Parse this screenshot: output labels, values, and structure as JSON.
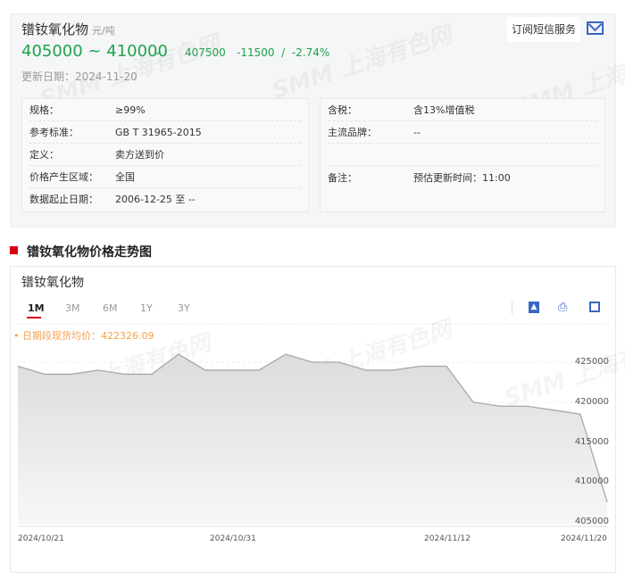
{
  "product": {
    "name": "镨钕氧化物",
    "unit": "元/吨",
    "price_range": "405000 ~ 410000",
    "trend_icon": "down-arrow-icon",
    "avg": "407500",
    "change": "-11500  /  -2.74%",
    "update_date": "更新日期：2024-11-20",
    "subscribe": "订阅短信服务"
  },
  "left_specs": [
    {
      "k": "规格：",
      "v": "≥99%"
    },
    {
      "k": "参考标准：",
      "v": "GB T 31965-2015"
    },
    {
      "k": "定义：",
      "v": "卖方送到价"
    },
    {
      "k": "价格产生区域：",
      "v": "全国"
    },
    {
      "k": "数据起止日期：",
      "v": "2006-12-25 至 --"
    }
  ],
  "right_specs": [
    {
      "k": "含税：",
      "v": "含13%增值税"
    },
    {
      "k": "主流品牌：",
      "v": "--"
    },
    {
      "k": "备注：",
      "v": "预估更新时间：11:00"
    }
  ],
  "section_title": "镨钕氧化物价格走势图",
  "watermark": "SMM 上海有色网",
  "chart_header": {
    "title": "镨钕氧化物",
    "tabs": [
      "1M",
      "3M",
      "6M",
      "1Y",
      "3Y"
    ],
    "active_tab": "1M",
    "avg_label": "• 日期段现货均价：422326.09"
  },
  "colors": {
    "green": "#1ea34a",
    "red": "#d7000f",
    "orange": "#f5a04a",
    "blue": "#3a66c4"
  },
  "chart_data": {
    "type": "area",
    "title": "镨钕氧化物",
    "x": [
      "2024/10/21",
      "2024/10/22",
      "2024/10/23",
      "2024/10/24",
      "2024/10/25",
      "2024/10/28",
      "2024/10/29",
      "2024/10/30",
      "2024/10/31",
      "2024/11/01",
      "2024/11/04",
      "2024/11/05",
      "2024/11/06",
      "2024/11/07",
      "2024/11/08",
      "2024/11/11",
      "2024/11/12",
      "2024/11/13",
      "2024/11/14",
      "2024/11/15",
      "2024/11/18",
      "2024/11/19",
      "2024/11/20"
    ],
    "values": [
      424500,
      423500,
      423500,
      424000,
      423500,
      423500,
      426000,
      424000,
      424000,
      424000,
      426000,
      425000,
      425000,
      424000,
      424000,
      424500,
      424500,
      420000,
      419500,
      419500,
      419000,
      418500,
      407500
    ],
    "x_tick_labels": [
      "2024/10/21",
      "2024/10/31",
      "2024/11/12",
      "2024/11/20"
    ],
    "y_ticks": [
      "425000",
      "420000",
      "415000",
      "410000",
      "405000"
    ],
    "ylim": [
      405000,
      425000
    ]
  }
}
